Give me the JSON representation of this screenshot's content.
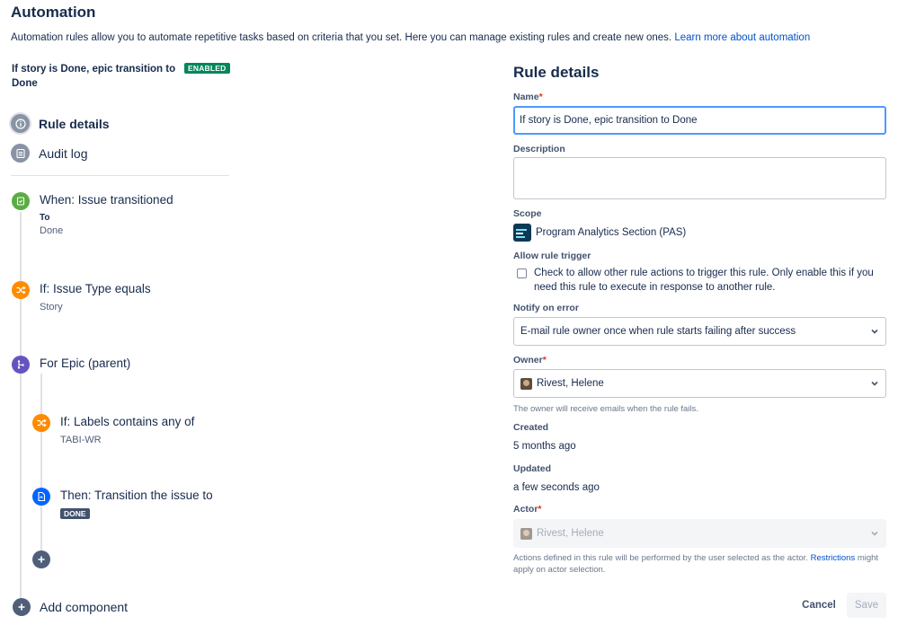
{
  "header": {
    "title": "Automation",
    "description": "Automation rules allow you to automate repetitive tasks based on criteria that you set. Here you can manage existing rules and create new ones.",
    "learn_more": "Learn more about automation"
  },
  "rule": {
    "name": "If story is Done, epic transition to Done",
    "status_badge": "ENABLED"
  },
  "nav": {
    "rule_details": "Rule details",
    "audit_log": "Audit log"
  },
  "components": [
    {
      "title": "When: Issue transitioned",
      "sub_label": "To",
      "sub_value": "Done",
      "icon": "trigger-icon",
      "color": "#5aac44"
    },
    {
      "title": "If: Issue Type equals",
      "sub_value": "Story",
      "icon": "condition-shuffle-icon",
      "color": "#ff8b00"
    },
    {
      "title": "For Epic (parent)",
      "icon": "branch-icon",
      "color": "#6554c0"
    },
    {
      "title": "If: Labels contains any of",
      "sub_value": "TABI-WR",
      "icon": "condition-shuffle-icon",
      "color": "#ff8b00"
    },
    {
      "title": "Then: Transition the issue to",
      "lozenge": "DONE",
      "icon": "action-icon",
      "color": "#0065ff"
    }
  ],
  "add_component": "Add component",
  "details": {
    "section_title": "Rule details",
    "name_label": "Name",
    "name_value": "If story is Done, epic transition to Done",
    "description_label": "Description",
    "description_value": "",
    "scope_label": "Scope",
    "scope_value": "Program Analytics Section (PAS)",
    "allow_trigger_label": "Allow rule trigger",
    "allow_trigger_text": "Check to allow other rule actions to trigger this rule. Only enable this if you need this rule to execute in response to another rule.",
    "allow_trigger_checked": false,
    "notify_label": "Notify on error",
    "notify_value": "E-mail rule owner once when rule starts failing after success",
    "owner_label": "Owner",
    "owner_value": "Rivest, Helene",
    "owner_help": "The owner will receive emails when the rule fails.",
    "created_label": "Created",
    "created_value": "5 months ago",
    "updated_label": "Updated",
    "updated_value": "a few seconds ago",
    "actor_label": "Actor",
    "actor_value": "Rivest, Helene",
    "actor_help": "Actions defined in this rule will be performed by the user selected as the actor.",
    "actor_help_link": "Restrictions",
    "actor_help_tail": "might apply on actor selection.",
    "required_mark": "*"
  },
  "buttons": {
    "cancel": "Cancel",
    "save": "Save"
  },
  "colors": {
    "enabled": "#00875a",
    "link": "#0052cc",
    "focus_border": "#4c9aff",
    "required": "#de350b"
  }
}
